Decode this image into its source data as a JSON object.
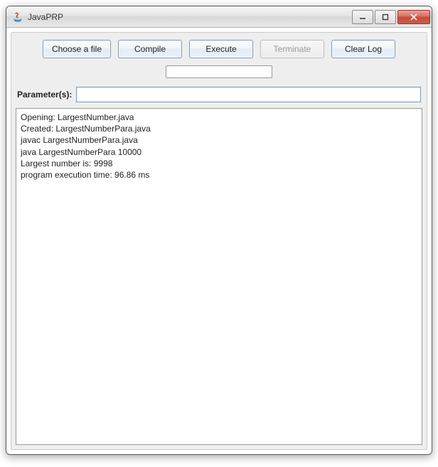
{
  "window": {
    "title": "JavaPRP"
  },
  "toolbar": {
    "choose_file": "Choose a file",
    "compile": "Compile",
    "execute": "Execute",
    "terminate": "Terminate",
    "clear_log": "Clear Log"
  },
  "parameters": {
    "label": "Parameter(s):",
    "value": ""
  },
  "log": {
    "lines": [
      "Opening: LargestNumber.java",
      "Created: LargestNumberPara.java",
      "javac LargestNumberPara.java",
      "java LargestNumberPara 10000",
      "Largest number is: 9998",
      "program execution time: 96.86 ms"
    ]
  }
}
